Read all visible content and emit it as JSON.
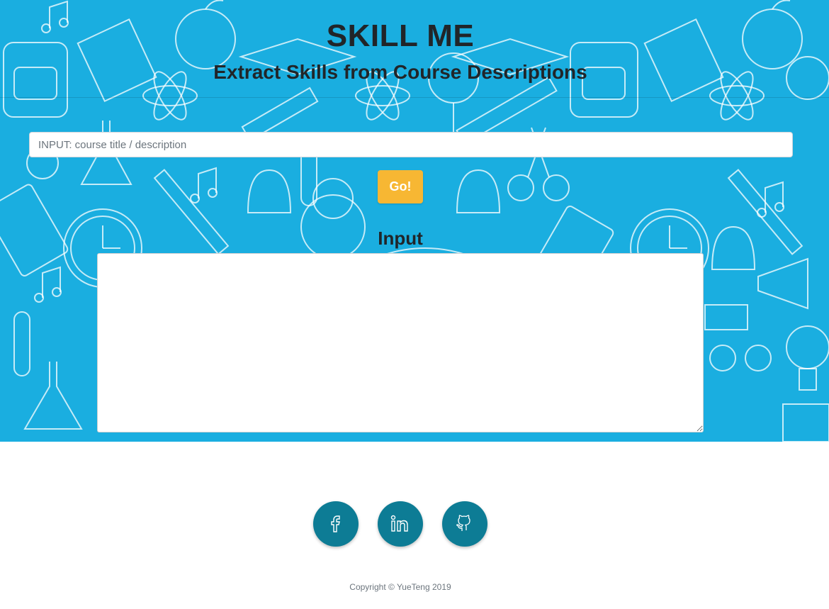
{
  "header": {
    "title": "SKILL ME",
    "subtitle": "Extract Skills from Course Descriptions"
  },
  "search": {
    "placeholder": "INPUT: course title / description",
    "value": ""
  },
  "go_button": {
    "label": "Go!"
  },
  "input_section": {
    "heading": "Input",
    "value": ""
  },
  "footer": {
    "social": [
      {
        "name": "facebook",
        "icon": "facebook-icon"
      },
      {
        "name": "linkedin",
        "icon": "linkedin-icon"
      },
      {
        "name": "github",
        "icon": "github-icon"
      }
    ],
    "copyright": "Copyright © YueTeng 2019"
  },
  "colors": {
    "hero_background": "#1aaee0",
    "button_accent": "#f7b733",
    "social_button": "#0d7c95",
    "heading_text": "#212529"
  }
}
